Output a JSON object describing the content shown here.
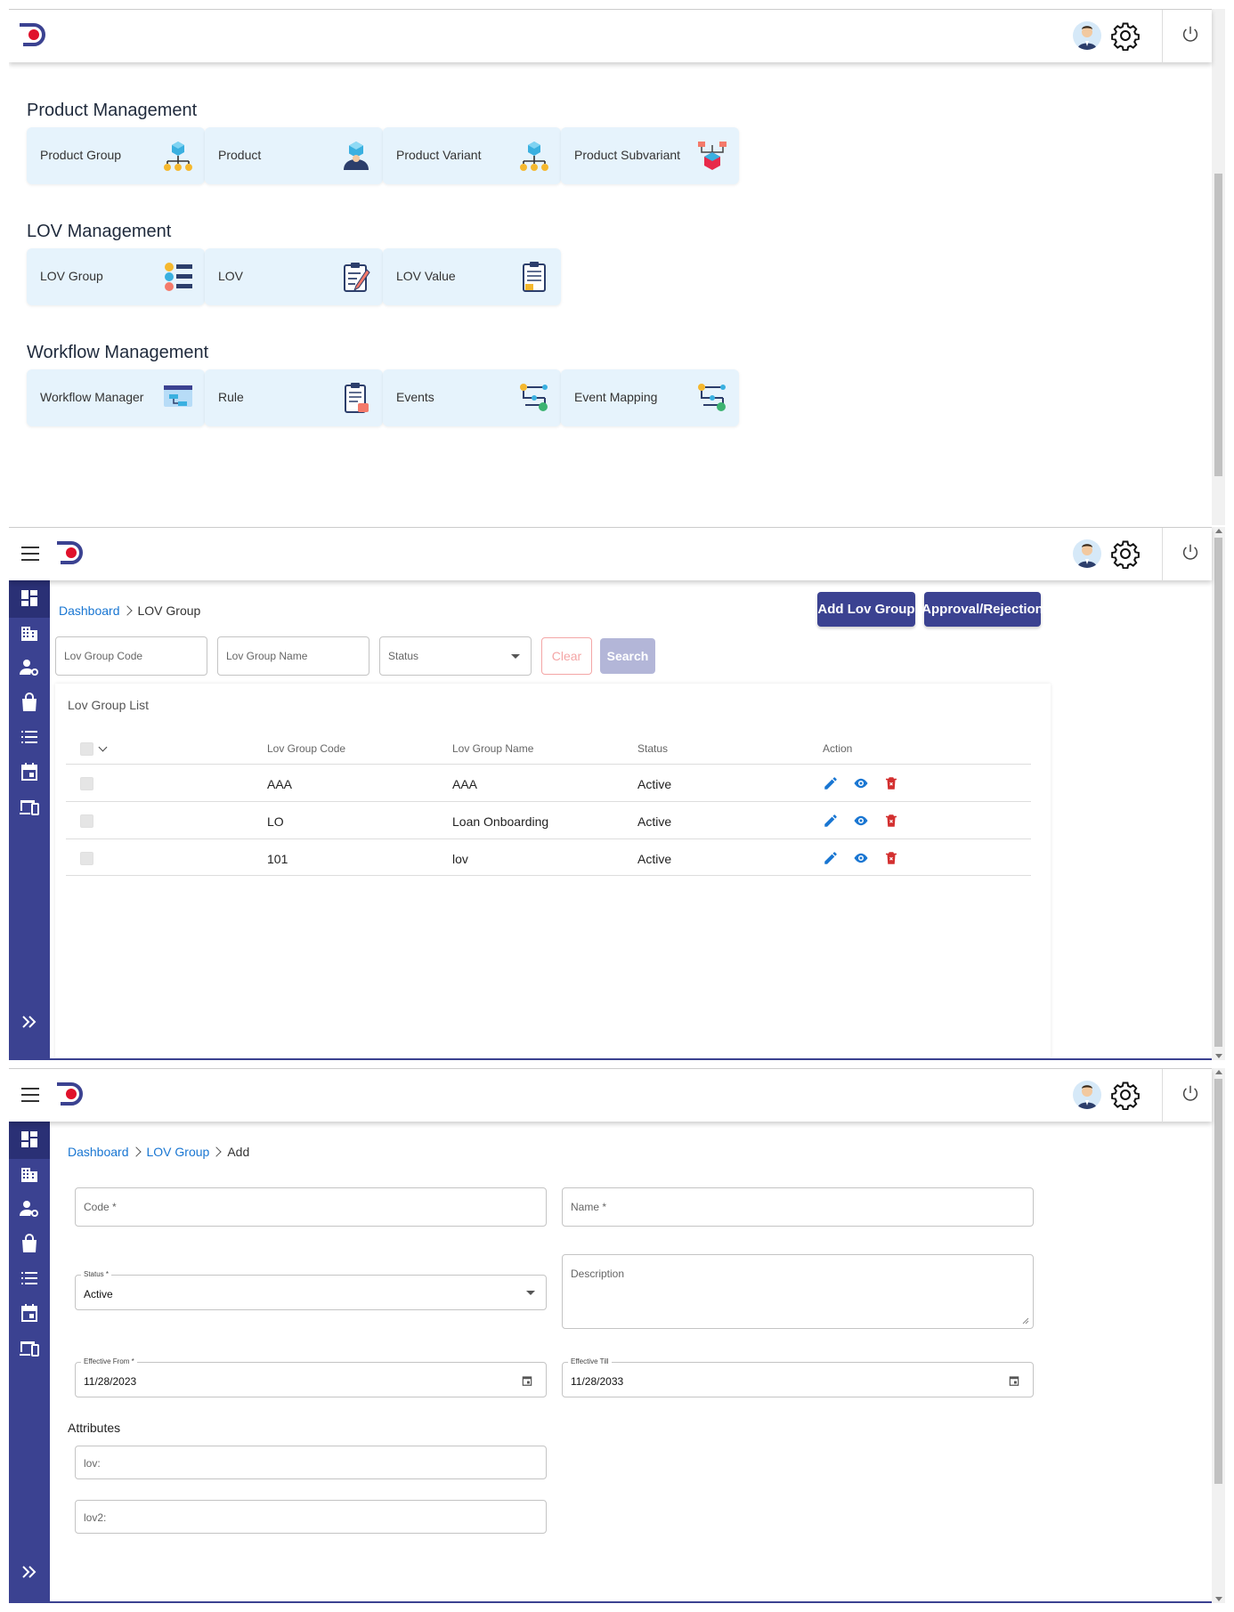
{
  "header": {
    "logo": "app-logo",
    "avatar": "user-avatar-icon",
    "settings": "gear-icon",
    "logout": "power-icon"
  },
  "dashboard": {
    "sections": [
      {
        "title": "Product Management",
        "tiles": [
          {
            "label": "Product Group",
            "icon": "product-group-icon"
          },
          {
            "label": "Product",
            "icon": "product-icon"
          },
          {
            "label": "Product Variant",
            "icon": "product-variant-icon"
          },
          {
            "label": "Product Subvariant",
            "icon": "product-subvariant-icon"
          }
        ]
      },
      {
        "title": "LOV Management",
        "tiles": [
          {
            "label": "LOV Group",
            "icon": "lov-group-icon"
          },
          {
            "label": "LOV",
            "icon": "lov-icon"
          },
          {
            "label": "LOV Value",
            "icon": "lov-value-icon"
          }
        ]
      },
      {
        "title": "Workflow Management",
        "tiles": [
          {
            "label": "Workflow Manager",
            "icon": "workflow-manager-icon"
          },
          {
            "label": "Rule",
            "icon": "rule-icon"
          },
          {
            "label": "Events",
            "icon": "events-icon"
          },
          {
            "label": "Event Mapping",
            "icon": "event-mapping-icon"
          }
        ]
      }
    ]
  },
  "lov_list": {
    "breadcrumb": {
      "home": "Dashboard",
      "current": "LOV Group"
    },
    "buttons": {
      "add": "Add Lov Group",
      "approval": "Approval/Rejection",
      "clear": "Clear",
      "search": "Search"
    },
    "filters": {
      "code_placeholder": "Lov Group Code",
      "name_placeholder": "Lov Group Name",
      "status_placeholder": "Status"
    },
    "list_title": "Lov Group List",
    "columns": [
      "Lov Group Code",
      "Lov Group Name",
      "Status",
      "Action"
    ],
    "rows": [
      {
        "code": "AAA",
        "name": "AAA",
        "status": "Active"
      },
      {
        "code": "LO",
        "name": "Loan Onboarding",
        "status": "Active"
      },
      {
        "code": "101",
        "name": "lov",
        "status": "Active"
      }
    ],
    "colors": {
      "edit": "#1976d2",
      "view": "#1976d2",
      "delete": "#d32f2f"
    }
  },
  "lov_add": {
    "breadcrumb": {
      "home": "Dashboard",
      "parent": "LOV Group",
      "current": "Add"
    },
    "fields": {
      "code": "Code *",
      "name": "Name *",
      "status_label": "Status *",
      "status_value": "Active",
      "description": "Description",
      "effective_from_label": "Effective From *",
      "effective_from_value": "11/28/2023",
      "effective_till_label": "Effective Till",
      "effective_till_value": "11/28/2033"
    },
    "attributes_title": "Attributes",
    "attributes": [
      "lov:",
      "lov2:"
    ]
  },
  "sidebar_icons": [
    "dashboard-icon",
    "building-icon",
    "user-settings-icon",
    "bag-icon",
    "list-icon",
    "calendar-icon",
    "devices-icon",
    "expand-icon"
  ],
  "theme": {
    "primary": "#3b4291",
    "sidebar": "#3b4291",
    "tile_bg": "#e6f3fc",
    "link": "#1976d2"
  }
}
